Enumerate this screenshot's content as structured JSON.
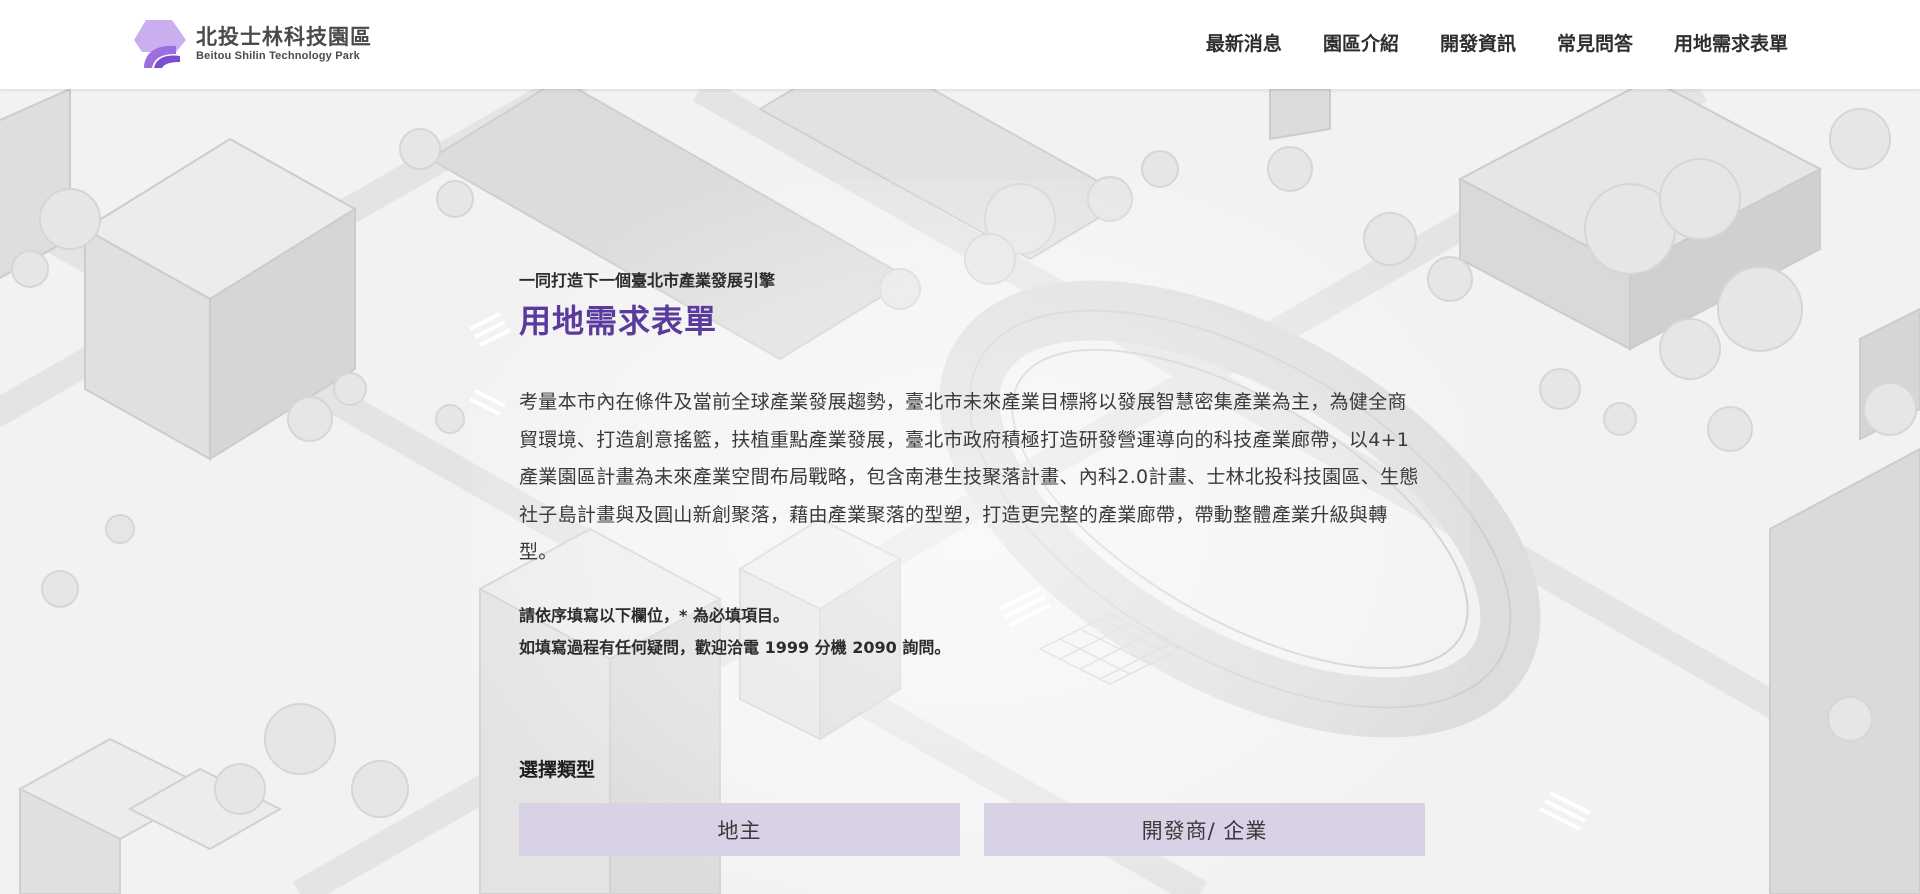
{
  "header": {
    "logo": {
      "name_zh": "北投士林科技園區",
      "name_en": "Beitou Shilin Technology Park",
      "icon": "park-logo-icon"
    },
    "nav": [
      {
        "label": "最新消息"
      },
      {
        "label": "園區介紹"
      },
      {
        "label": "開發資訊"
      },
      {
        "label": "常見問答"
      },
      {
        "label": "用地需求表單"
      }
    ]
  },
  "main": {
    "subtitle": "一同打造下一個臺北市產業發展引擎",
    "title": "用地需求表單",
    "intro": "考量本市內在條件及當前全球產業發展趨勢，臺北市未來產業目標將以發展智慧密集產業為主，為健全商貿環境、打造創意搖籃，扶植重點產業發展，臺北市政府積極打造研發營運導向的科技產業廊帶，以4+1產業園區計畫為未來產業空間布局戰略，包含南港生技聚落計畫、內科2.0計畫、士林北投科技園區、生態社子島計畫與及圓山新創聚落，藉由產業聚落的型塑，打造更完整的產業廊帶，帶動整體產業升級與轉型。",
    "notes": [
      "請依序填寫以下欄位，* 為必填項目。",
      "如填寫過程有任何疑問，歡迎洽電 1999 分機 2090 詢問。"
    ],
    "type_section": {
      "label": "選擇類型",
      "options": [
        {
          "label": "地主"
        },
        {
          "label": "開發商/ 企業"
        }
      ]
    }
  },
  "colors": {
    "accent": "#5b3a9e",
    "button_bg": "#d9d1e6",
    "logo_purple": "#a77ee0",
    "header_bg": "#ffffff",
    "background": "#f4f4f4"
  }
}
